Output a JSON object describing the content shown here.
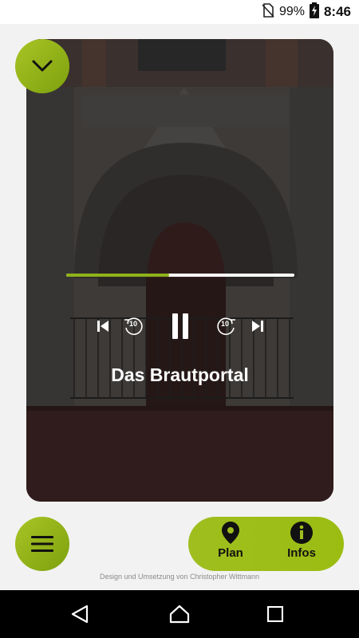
{
  "status_bar": {
    "battery": "99%",
    "time": "8:46"
  },
  "player": {
    "title": "Das Brautportal",
    "progress": 0.45,
    "controls": {
      "previous": "skip-previous-icon",
      "rewind_seconds": "10",
      "pause": "pause-icon",
      "forward_seconds": "10",
      "next": "skip-next-icon"
    }
  },
  "bottom_nav": {
    "plan_label": "Plan",
    "infos_label": "Infos"
  },
  "footer": {
    "credit": "Design und Umsetzung von Christopher Wittmann"
  },
  "colors": {
    "accent": "#9fbe1f",
    "accent_dark": "#7da10e",
    "background": "#f2f2f2"
  }
}
